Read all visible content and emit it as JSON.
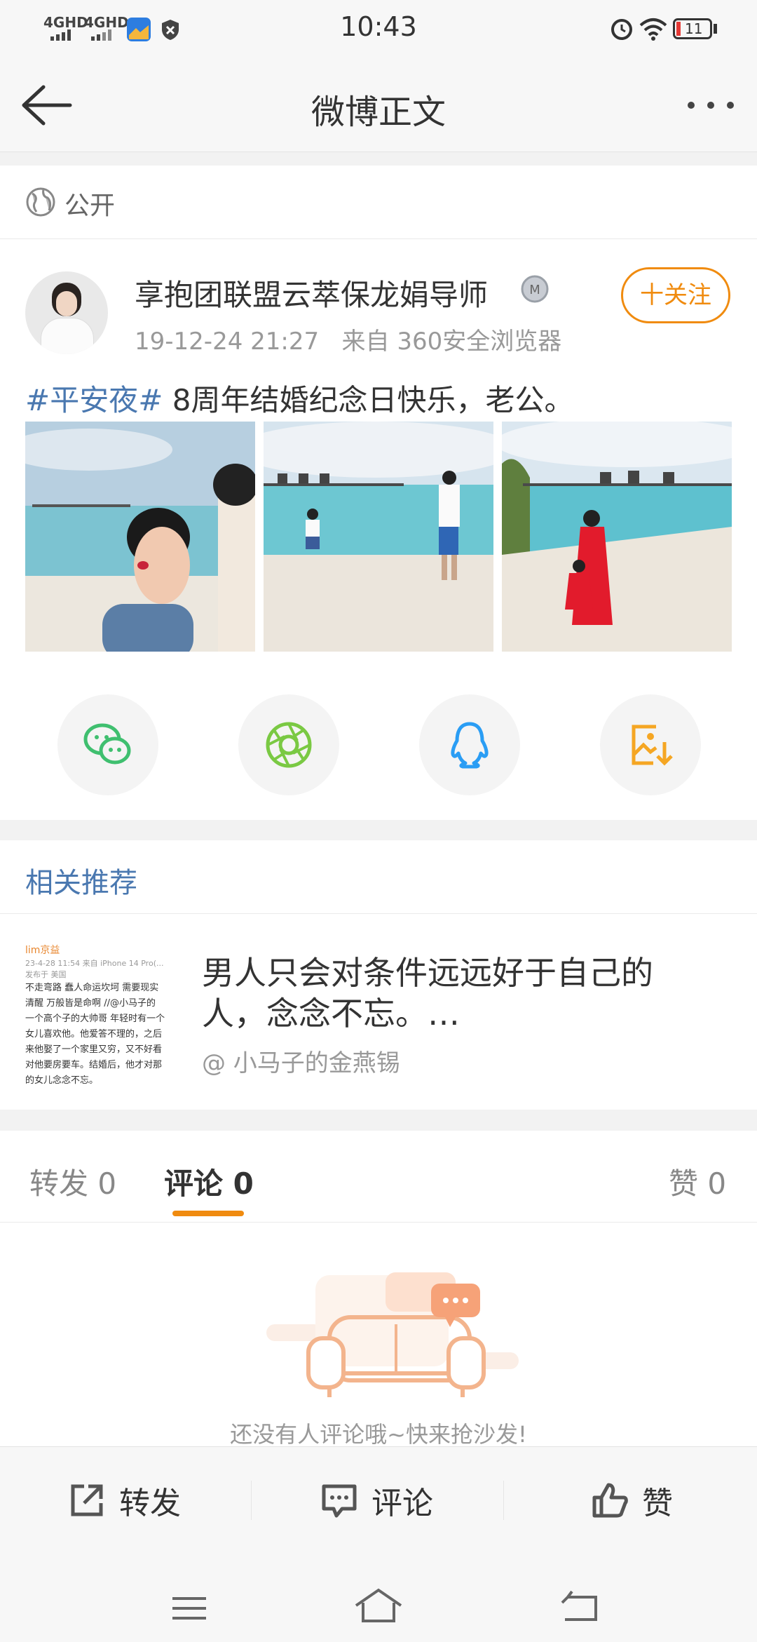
{
  "status": {
    "time": "10:43",
    "signal1": "4GHD",
    "signal2": "4GHD",
    "battery": "11"
  },
  "nav": {
    "title": "微博正文"
  },
  "visibility": {
    "label": "公开"
  },
  "post": {
    "author": "享抱团联盟云萃保龙娟导师",
    "follow_label": "十关注",
    "meta": "19-12-24 21:27   来自 360安全浏览器",
    "tag": "#平安夜#",
    "text": " 8周年结婚纪念日快乐，老公。"
  },
  "share_icons": [
    "wechat-icon",
    "moments-icon",
    "qq-icon",
    "save-image-icon"
  ],
  "related": {
    "title": "相关推荐",
    "item_title": "男人只会对条件远远好于自己的人，念念不忘。…",
    "item_source": "@ 小马子的金燕锡",
    "thumb_header": "lim京益",
    "thumb_date": "23-4-28 11:54  来自 iPhone 14 Pro(...",
    "thumb_loc": "发布于 美国",
    "thumb_lines": [
      "不走弯路 蠢人命运坎坷 需要现实",
      "清醒 万般皆是命啊 //@小马子的",
      "一个高个子的大帅哥 年轻时有一个",
      "女儿喜欢他。他爱答不理的，之后",
      "来他娶了一个家里又穷，又不好看",
      "对他要房要车。结婚后，他才对那",
      "的女儿念念不忘。"
    ]
  },
  "tabs": {
    "repost": "转发 0",
    "comment": "评论 0",
    "like": "赞 0"
  },
  "empty_text": "还没有人评论哦~快来抢沙发!",
  "actions": {
    "repost": "转发",
    "comment": "评论",
    "like": "赞"
  },
  "colors": {
    "accent": "#f08b0f",
    "tag": "#4a78b0",
    "wechat": "#3fbf6f",
    "qq": "#2a9df4"
  }
}
